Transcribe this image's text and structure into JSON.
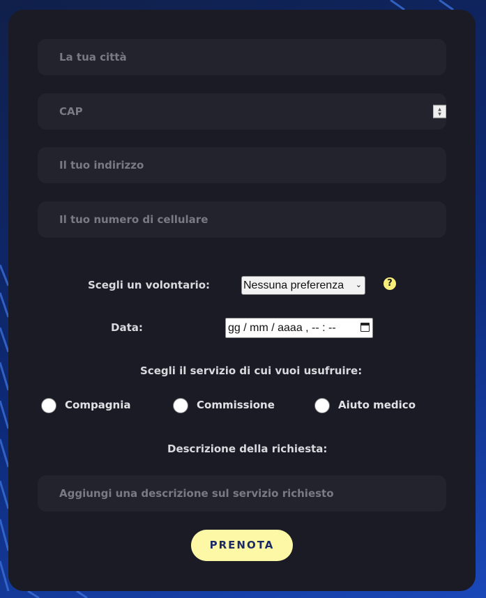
{
  "form": {
    "city_placeholder": "La tua città",
    "cap_placeholder": "CAP",
    "address_placeholder": "Il tuo indirizzo",
    "phone_placeholder": "Il tuo numero di cellulare",
    "volunteer_label": "Scegli un volontario:",
    "volunteer_selected": "Nessuna preferenza",
    "help_symbol": "?",
    "date_label": "Data:",
    "date_value": "gg / mm / aaaa , -- : --",
    "service_label": "Scegli il servizio di cui vuoi usufruire:",
    "services": [
      {
        "label": "Compagnia"
      },
      {
        "label": "Commissione"
      },
      {
        "label": "Aiuto medico"
      }
    ],
    "description_label": "Descrizione della richiesta:",
    "description_placeholder": "Aggiungi una descrizione sul servizio richiesto",
    "submit_label": "PRENOTA"
  },
  "colors": {
    "card_bg": "#1b1b25",
    "field_bg": "#23232e",
    "accent_button": "#fdf8a6",
    "button_text": "#1c2a66",
    "help_icon": "#f7ef7a"
  },
  "icons": [
    "number-spinner-icon",
    "chevron-down-icon",
    "help-icon",
    "calendar-icon"
  ]
}
